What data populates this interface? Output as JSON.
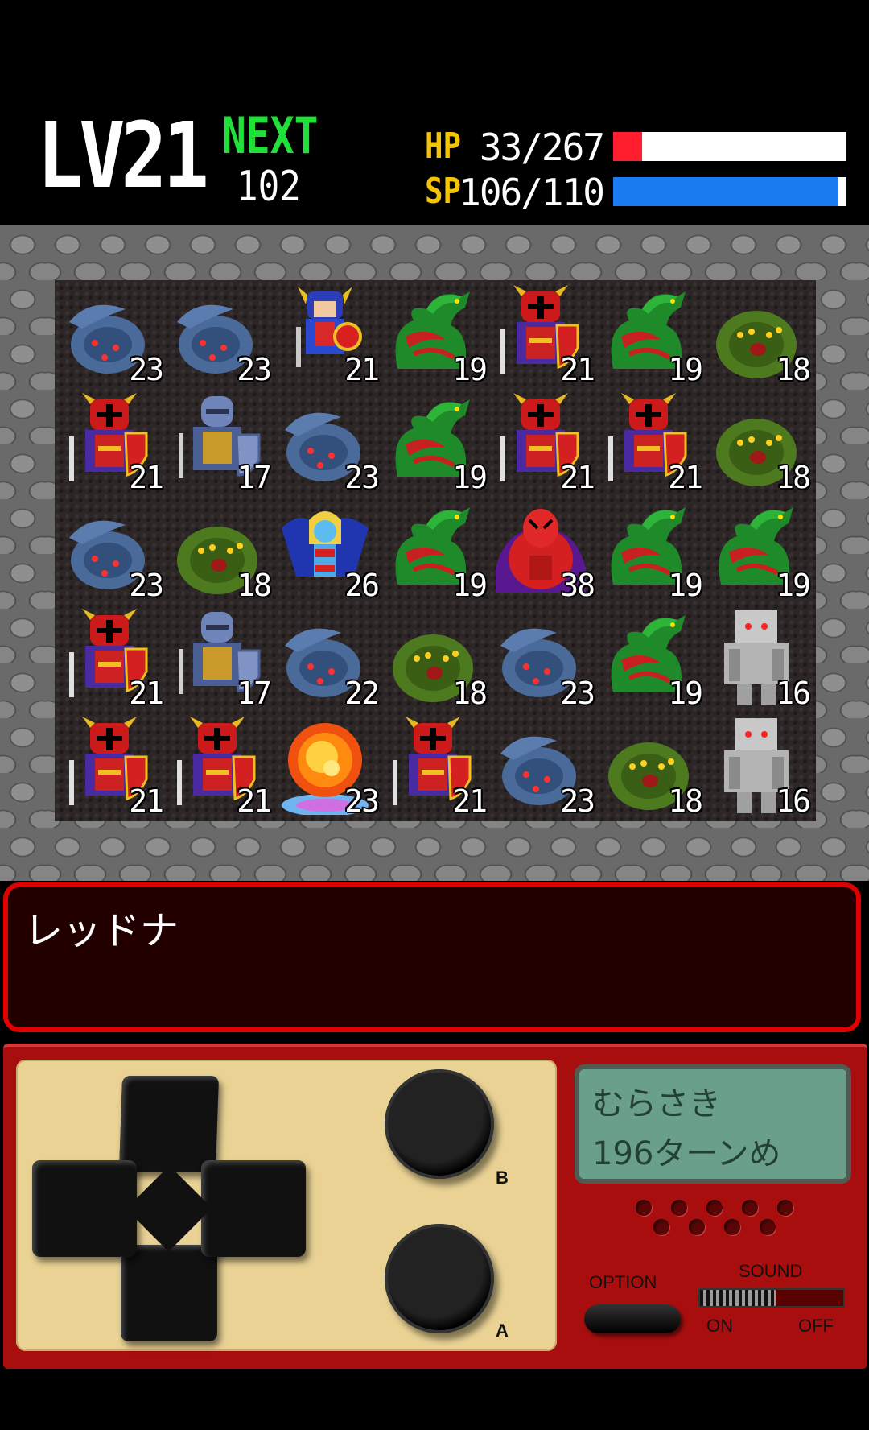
{
  "status": {
    "level_label": "LV",
    "level": "21",
    "next_label": "NEXT",
    "next_value": "102",
    "hp_label": "HP",
    "hp_value": "33/267",
    "hp_fraction": 0.1236,
    "hp_color": "#ff1e2e",
    "sp_label": "SP",
    "sp_value": "106/110",
    "sp_fraction": 0.9636,
    "sp_color": "#1b7cf2"
  },
  "board": {
    "rows": [
      [
        {
          "type": "serpent",
          "level": "23"
        },
        {
          "type": "serpent",
          "level": "23"
        },
        {
          "type": "hero",
          "level": "21"
        },
        {
          "type": "dragon",
          "level": "19"
        },
        {
          "type": "dark-knight",
          "level": "21"
        },
        {
          "type": "dragon",
          "level": "19"
        },
        {
          "type": "hydra",
          "level": "18"
        }
      ],
      [
        {
          "type": "dark-knight",
          "level": "21"
        },
        {
          "type": "blue-knight",
          "level": "17"
        },
        {
          "type": "serpent",
          "level": "23"
        },
        {
          "type": "dragon",
          "level": "19"
        },
        {
          "type": "dark-knight",
          "level": "21"
        },
        {
          "type": "dark-knight",
          "level": "21"
        },
        {
          "type": "hydra",
          "level": "18"
        }
      ],
      [
        {
          "type": "serpent",
          "level": "23"
        },
        {
          "type": "hydra",
          "level": "18"
        },
        {
          "type": "harpy",
          "level": "26"
        },
        {
          "type": "dragon",
          "level": "19"
        },
        {
          "type": "red-demon",
          "level": "38"
        },
        {
          "type": "dragon",
          "level": "19"
        },
        {
          "type": "dragon",
          "level": "19"
        }
      ],
      [
        {
          "type": "dark-knight",
          "level": "21"
        },
        {
          "type": "blue-knight",
          "level": "17"
        },
        {
          "type": "serpent",
          "level": "22"
        },
        {
          "type": "hydra",
          "level": "18"
        },
        {
          "type": "serpent",
          "level": "23"
        },
        {
          "type": "dragon",
          "level": "19"
        },
        {
          "type": "golem",
          "level": "16"
        }
      ],
      [
        {
          "type": "dark-knight",
          "level": "21"
        },
        {
          "type": "dark-knight",
          "level": "21"
        },
        {
          "type": "fire",
          "level": "23"
        },
        {
          "type": "dark-knight",
          "level": "21"
        },
        {
          "type": "serpent",
          "level": "23"
        },
        {
          "type": "hydra",
          "level": "18"
        },
        {
          "type": "golem",
          "level": "16"
        }
      ]
    ]
  },
  "message": {
    "text": "レッドナ"
  },
  "lcd": {
    "line1": "むらさき",
    "line2": "196ターンめ"
  },
  "controls": {
    "b_label": "B",
    "a_label": "A",
    "option_label": "OPTION",
    "sound_label": "SOUND",
    "sound_on_label": "ON",
    "sound_off_label": "OFF",
    "sound_level": 0.53,
    "dpad_icon": "dpad-icon"
  },
  "colors": {
    "next": "#22e03a",
    "stat_label": "#f4c400",
    "message_border": "#e00000",
    "controller_body": "#a80e0e",
    "pad_panel": "#e9d294",
    "lcd_screen": "#6aa08a"
  }
}
